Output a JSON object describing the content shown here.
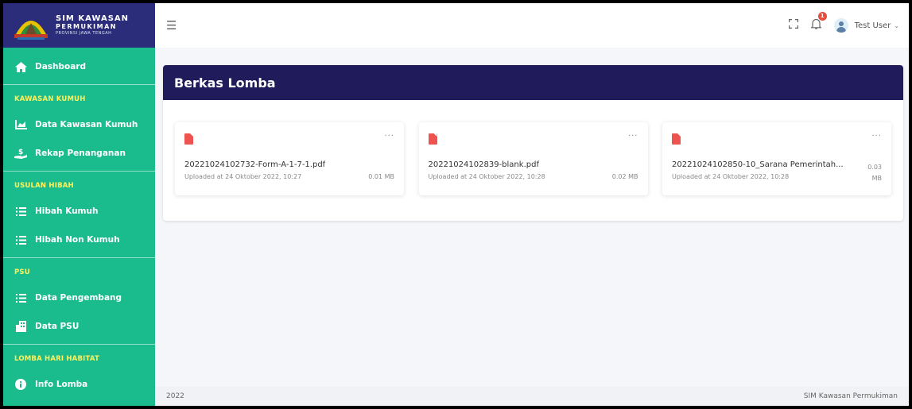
{
  "brand": {
    "line1": "SIM KAWASAN",
    "line2": "PERMUKIMAN",
    "line3": "PROVINSI JAWA TENGAH"
  },
  "sidebar": {
    "dashboard": "Dashboard",
    "section_kumuh": "KAWASAN KUMUH",
    "data_kawasan": "Data Kawasan Kumuh",
    "rekap": "Rekap Penanganan",
    "section_hibah": "USULAN HIBAH",
    "hibah_kumuh": "Hibah Kumuh",
    "hibah_non": "Hibah Non Kumuh",
    "section_psu": "PSU",
    "data_pengembang": "Data Pengembang",
    "data_psu": "Data PSU",
    "section_lomba": "LOMBA HARI HABITAT",
    "info_lomba": "Info Lomba"
  },
  "header": {
    "notif_count": "1",
    "user_name": "Test User"
  },
  "main": {
    "title": "Berkas Lomba",
    "files": [
      {
        "name": "20221024102732-Form-A-1-7-1.pdf",
        "uploaded": "Uploaded at 24 Oktober 2022, 10:27",
        "size": "0.01 MB"
      },
      {
        "name": "20221024102839-blank.pdf",
        "uploaded": "Uploaded at 24 Oktober 2022, 10:28",
        "size": "0.02 MB"
      },
      {
        "name": "20221024102850-10_Sarana Pemerintah...",
        "uploaded": "Uploaded at 24 Oktober 2022, 10:28",
        "size": "0.03 MB"
      }
    ]
  },
  "footer": {
    "year": "2022",
    "app": "SIM Kawasan Permukiman"
  },
  "colors": {
    "sidebar": "#1abc8d",
    "brand_bg": "#2b2d7a",
    "section_text": "#fff25c",
    "panel_header": "#201c5c",
    "pdf": "#ef5350"
  }
}
